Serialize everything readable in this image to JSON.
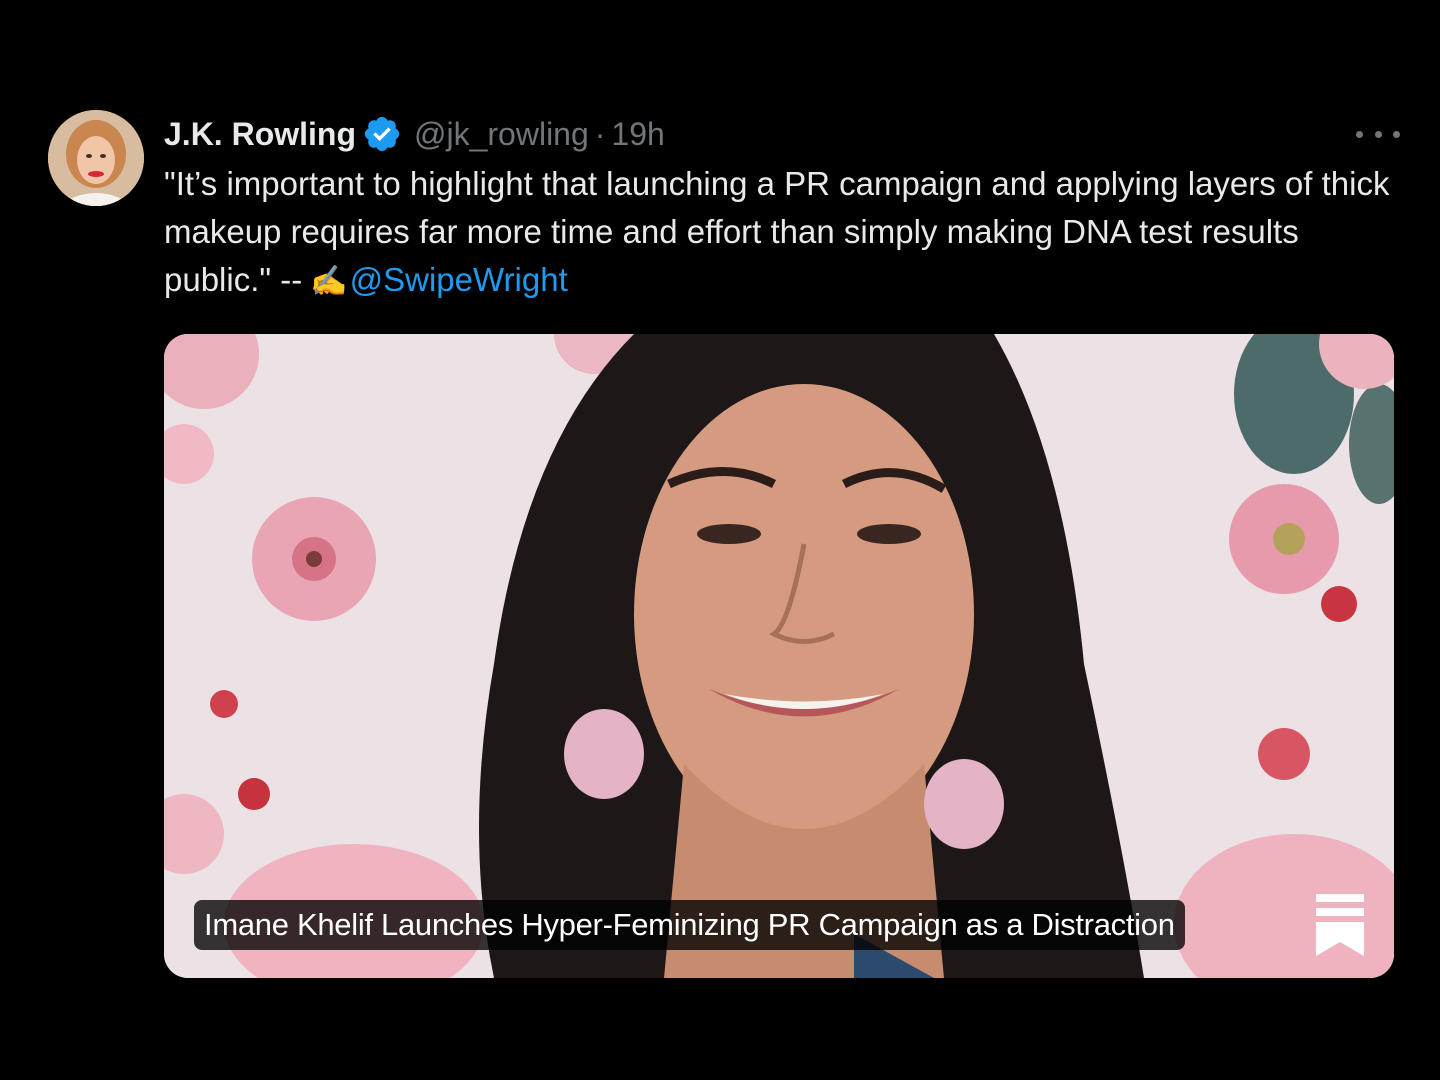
{
  "tweet": {
    "author_name": "J.K. Rowling",
    "handle": "@jk_rowling",
    "separator": "·",
    "time": "19h",
    "text_main": "\"It’s important to highlight that launching a PR campaign and applying layers of thick makeup requires far more time and effort than simply making DNA test results public.\" --",
    "emoji": "✍️",
    "mention": "@SwipeWright",
    "media_caption": "Imane Khelif Launches Hyper-Feminizing PR Campaign as a Distraction"
  },
  "icons": {
    "verified": "verified-badge-icon",
    "more": "more-options-icon",
    "bookmark": "substack-bookmark-icon"
  },
  "colors": {
    "background": "#000000",
    "text": "#e7e9ea",
    "secondary_text": "#71767b",
    "link": "#1d9bf0",
    "verified": "#1d9bf0"
  }
}
